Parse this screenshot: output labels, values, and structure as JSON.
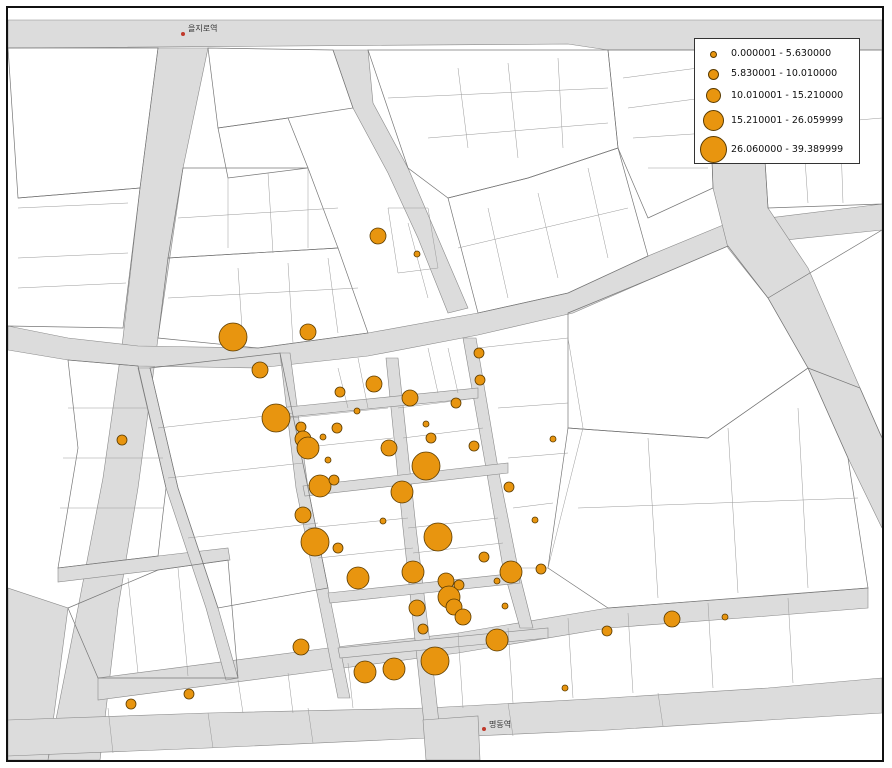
{
  "map": {
    "stations": [
      {
        "name": "을지로역"
      },
      {
        "name": "명동역"
      }
    ],
    "symbol_color": "#e8950f",
    "road_color": "#dcdcdc"
  },
  "legend": {
    "classes": [
      {
        "label": "0.000001 - 5.630000"
      },
      {
        "label": "5.830001 - 10.010000"
      },
      {
        "label": "10.010001 - 15.210000"
      },
      {
        "label": "15.210001 - 26.059999"
      },
      {
        "label": "26.060000 - 39.389999"
      }
    ]
  }
}
